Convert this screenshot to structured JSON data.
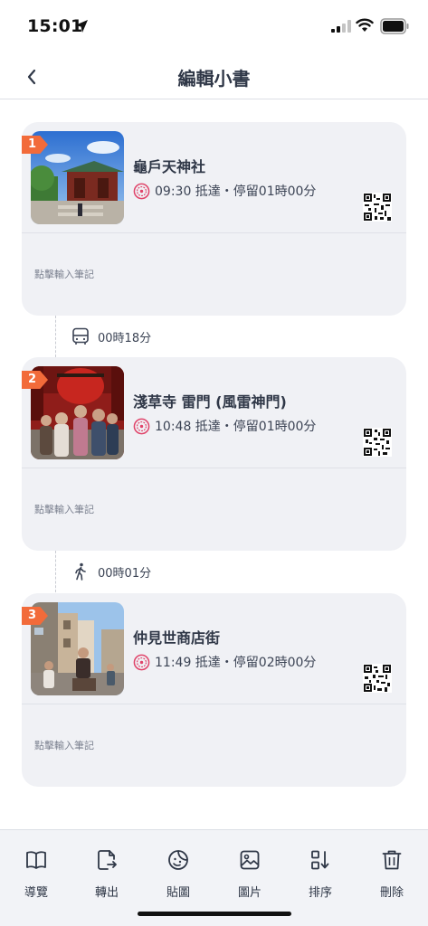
{
  "status_bar": {
    "time": "15:01",
    "location_icon": "location-arrow-icon",
    "signal_icon": "cellular-signal-icon",
    "wifi_icon": "wifi-icon",
    "battery_icon": "battery-icon"
  },
  "header": {
    "title": "編輯小書",
    "back_icon": "chevron-left-icon"
  },
  "stops": [
    {
      "index": "1",
      "name": "龜戶天神社",
      "time_info": "09:30 抵達・停留01時00分",
      "note_placeholder": "點擊輸入筆記",
      "photo_icon": "shrine-photo"
    },
    {
      "index": "2",
      "name": "淺草寺 雷門 (風雷神門)",
      "time_info": "10:48 抵達・停留01時00分",
      "note_placeholder": "點擊輸入筆記",
      "photo_icon": "temple-gate-photo"
    },
    {
      "index": "3",
      "name": "仲見世商店街",
      "time_info": "11:49 抵達・停留02時00分",
      "note_placeholder": "點擊輸入筆記",
      "photo_icon": "street-photo"
    }
  ],
  "transits": [
    {
      "mode": "bus-icon",
      "duration": "00時18分"
    },
    {
      "mode": "walking-icon",
      "duration": "00時01分"
    }
  ],
  "toolbar": {
    "items": [
      {
        "label": "導覽",
        "icon": "book-icon"
      },
      {
        "label": "轉出",
        "icon": "export-icon"
      },
      {
        "label": "貼圖",
        "icon": "sticker-icon"
      },
      {
        "label": "圖片",
        "icon": "image-icon"
      },
      {
        "label": "排序",
        "icon": "sort-icon"
      },
      {
        "label": "刪除",
        "icon": "trash-icon"
      }
    ]
  },
  "colors": {
    "badge": "#f26b3a",
    "card_bg": "#f0f1f5",
    "text": "#2f3747",
    "seal": "#e0446a"
  }
}
